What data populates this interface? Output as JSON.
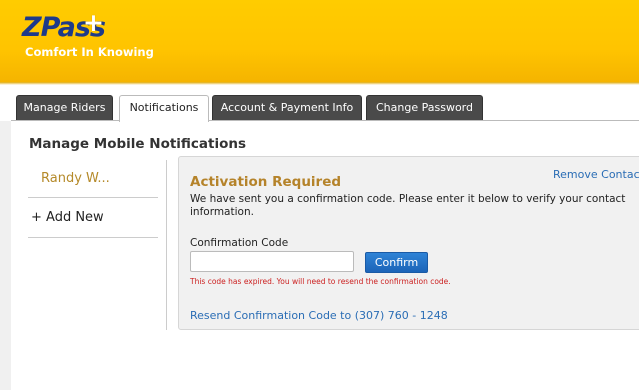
{
  "brand": {
    "logo_text": "ZPass",
    "logo_plus": "+",
    "tagline": "Comfort In Knowing"
  },
  "tabs": [
    {
      "label": "Manage Riders",
      "active": false
    },
    {
      "label": "Notifications",
      "active": true
    },
    {
      "label": "Account & Payment Info",
      "active": false
    },
    {
      "label": "Change Password",
      "active": false
    }
  ],
  "section_title": "Manage Mobile Notifications",
  "contacts": {
    "items": [
      {
        "label": "Randy W..."
      }
    ],
    "add_new": "+ Add New"
  },
  "activation": {
    "remove_contact": "Remove Contact",
    "title": "Activation Required",
    "message": "We have sent you a confirmation code. Please enter it below to verify your contact information.",
    "code_label": "Confirmation Code",
    "code_value": "",
    "confirm_label": "Confirm",
    "error": "This code has expired. You will need to resend the confirmation code.",
    "resend_link": "Resend Confirmation Code to (307) 760 - 1248"
  },
  "colors": {
    "header": "#ffc400",
    "brand_blue": "#1e3a8a",
    "accent_gold": "#b5832a",
    "link_blue": "#2a6db5",
    "error_red": "#cc2222",
    "button_blue": "#1c64b8"
  }
}
